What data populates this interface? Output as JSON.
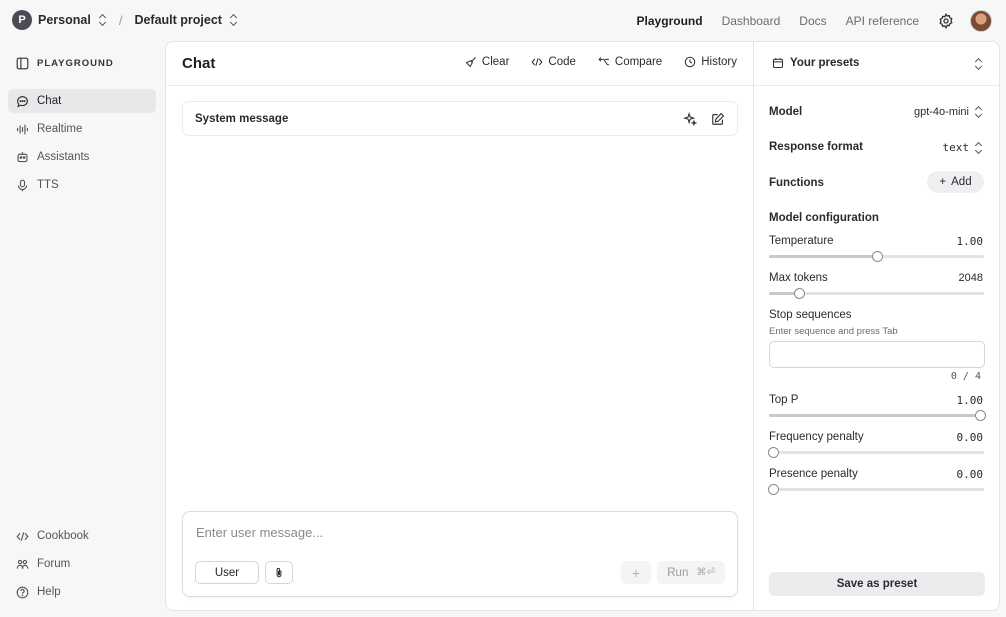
{
  "topbar": {
    "org_initial": "P",
    "org": "Personal",
    "separator": "/",
    "project": "Default project",
    "nav": [
      "Playground",
      "Dashboard",
      "Docs",
      "API reference"
    ],
    "active_nav": "Playground"
  },
  "sidebar": {
    "heading": "PLAYGROUND",
    "items": [
      {
        "label": "Chat",
        "icon": "chat-bubble-icon",
        "active": true
      },
      {
        "label": "Realtime",
        "icon": "waveform-icon",
        "active": false
      },
      {
        "label": "Assistants",
        "icon": "robot-icon",
        "active": false
      },
      {
        "label": "TTS",
        "icon": "microphone-icon",
        "active": false
      }
    ],
    "footer": [
      {
        "label": "Cookbook",
        "icon": "code-icon"
      },
      {
        "label": "Forum",
        "icon": "people-icon"
      },
      {
        "label": "Help",
        "icon": "help-circle-icon"
      }
    ]
  },
  "main": {
    "title": "Chat",
    "actions": [
      "Clear",
      "Code",
      "Compare",
      "History"
    ],
    "system_message_label": "System message",
    "composer": {
      "placeholder": "Enter user message...",
      "role": "User",
      "plus": "+",
      "run_label": "Run",
      "run_shortcut": "⌘⏎"
    }
  },
  "settings": {
    "presets_label": "Your presets",
    "model_label": "Model",
    "model_value": "gpt-4o-mini",
    "response_format_label": "Response format",
    "response_format_value": "text",
    "functions_label": "Functions",
    "add_label": "Add",
    "model_config_label": "Model configuration",
    "temperature": {
      "label": "Temperature",
      "value": "1.00",
      "fraction": 0.5
    },
    "max_tokens": {
      "label": "Max tokens",
      "value": "2048",
      "fraction": 0.14
    },
    "stop_sequences": {
      "label": "Stop sequences",
      "hint": "Enter sequence and press Tab",
      "count": "0 / 4"
    },
    "top_p": {
      "label": "Top P",
      "value": "1.00",
      "fraction": 0.98
    },
    "frequency_penalty": {
      "label": "Frequency penalty",
      "value": "0.00",
      "fraction": 0.02
    },
    "presence_penalty": {
      "label": "Presence penalty",
      "value": "0.00",
      "fraction": 0.02
    },
    "save_preset_label": "Save as preset"
  }
}
